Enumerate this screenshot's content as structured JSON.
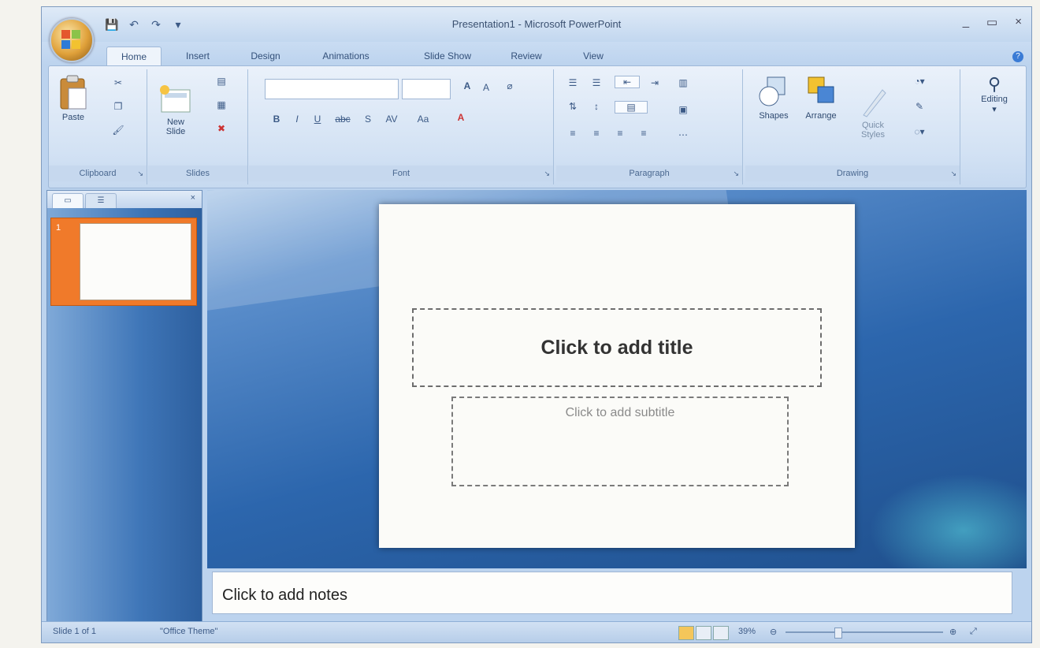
{
  "window": {
    "title": "Presentation1 - Microsoft PowerPoint"
  },
  "titlebar": {
    "controls": [
      "_",
      "▭",
      "×"
    ]
  },
  "qat": [
    "💾",
    "↶",
    "↷",
    "▾"
  ],
  "tabs": [
    "Home",
    "Insert",
    "Design",
    "Animations",
    "Slide Show",
    "Review",
    "View"
  ],
  "ribbon": {
    "clipboard": {
      "label": "Clipboard",
      "paste": "Paste"
    },
    "slides": {
      "label": "Slides",
      "new_slide": "New\nSlide"
    },
    "font": {
      "label": "Font",
      "grow": "A",
      "shrink": "A",
      "bold": "B",
      "italic": "I",
      "underline": "U",
      "strike": "abc",
      "shadow": "S",
      "spacing": "AV",
      "case": "Aa",
      "color": "A"
    },
    "paragraph": {
      "label": "Paragraph"
    },
    "drawing": {
      "label": "Drawing",
      "shapes": "Shapes",
      "arrange": "Arrange",
      "quick_styles": "Quick\nStyles"
    },
    "editing": {
      "label": "Editing"
    }
  },
  "slide": {
    "title_placeholder": "Click to add title",
    "subtitle_placeholder": "Click to add subtitle"
  },
  "thumbnail": {
    "number": "1"
  },
  "notes": {
    "placeholder": "Click to add notes"
  },
  "status": {
    "slide": "Slide 1 of 1",
    "theme": "\"Office Theme\"",
    "zoom": "39%"
  }
}
